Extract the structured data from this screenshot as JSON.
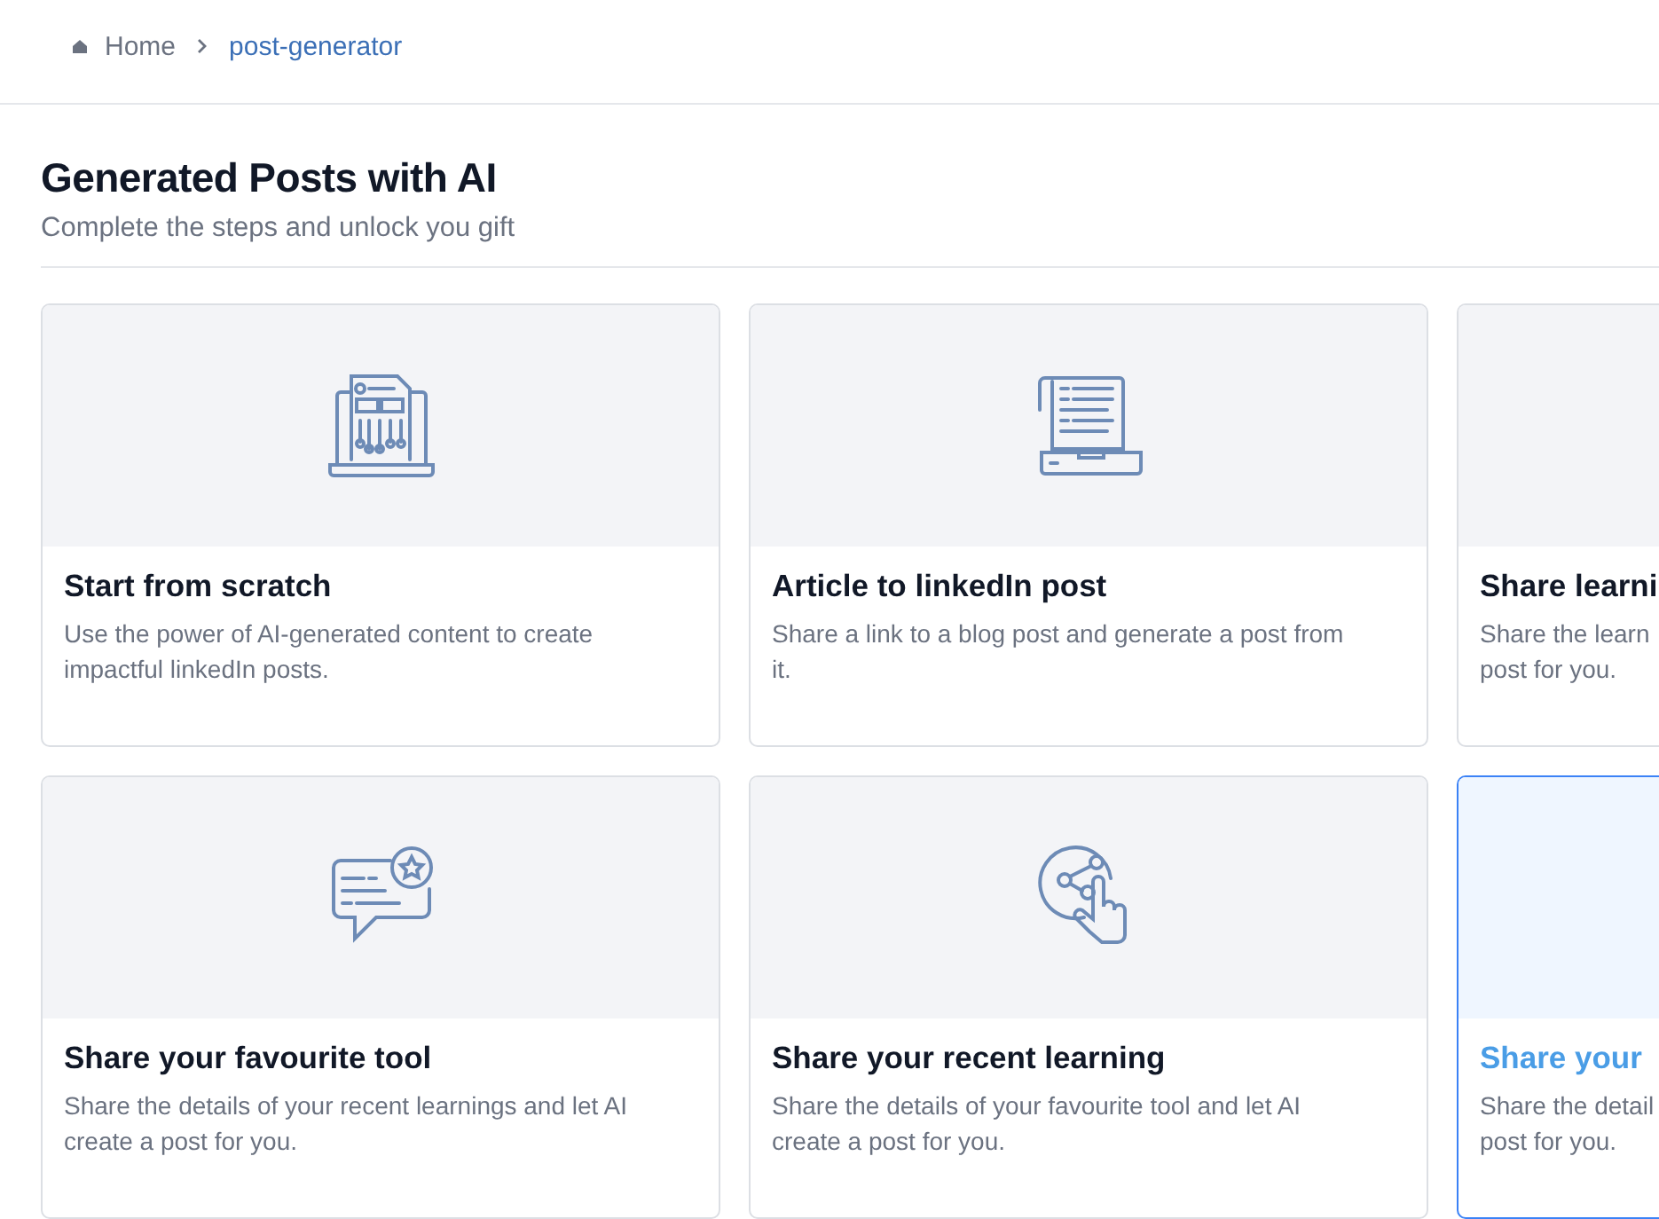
{
  "breadcrumb": [
    {
      "label": "Home",
      "kind": "home"
    },
    {
      "label": "post-generator",
      "kind": "current"
    }
  ],
  "header": {
    "title": "Generated Posts with AI",
    "subtitle": "Complete the steps and unlock you gift"
  },
  "cards": [
    {
      "title": "Start from scratch",
      "description_lines": [
        "Use the power of AI-generated content to create",
        "impactful linkedIn posts."
      ],
      "kind": "laptop-circuit",
      "selected": false
    },
    {
      "title": "Article to linkedIn post",
      "description_lines": [
        "Share a link to a blog post and generate a post from",
        "it."
      ],
      "kind": "laptop-document",
      "selected": false
    },
    {
      "title": "Share learni",
      "description_lines": [
        "Share the learn",
        "post for you."
      ],
      "kind": "blank",
      "selected": false
    },
    {
      "title": "Share your favourite tool",
      "description_lines": [
        "Share the details of your recent learnings and let AI",
        "create a post for you."
      ],
      "kind": "chat-star",
      "selected": false
    },
    {
      "title": "Share your recent learning",
      "description_lines": [
        "Share the details of your favourite tool and let AI",
        "create a post for you."
      ],
      "kind": "share-hand",
      "selected": false
    },
    {
      "title": "Share your",
      "description_lines": [
        "Share the detail",
        "post for you."
      ],
      "kind": "blank",
      "selected": true
    }
  ]
}
